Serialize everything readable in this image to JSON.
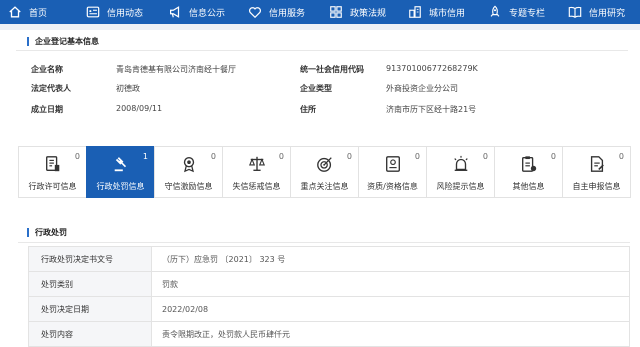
{
  "nav": [
    {
      "label": "首页",
      "icon": "home-icon"
    },
    {
      "label": "信用动态",
      "icon": "news-icon"
    },
    {
      "label": "信息公示",
      "icon": "megaphone-icon"
    },
    {
      "label": "信用服务",
      "icon": "heart-icon"
    },
    {
      "label": "政策法规",
      "icon": "grid-icon"
    },
    {
      "label": "城市信用",
      "icon": "city-icon"
    },
    {
      "label": "专题专栏",
      "icon": "rocket-icon"
    },
    {
      "label": "信用研究",
      "icon": "book-icon"
    }
  ],
  "basic_info": {
    "title": "企业登记基本信息",
    "fields": [
      {
        "label": "企业名称",
        "value": "青岛肯德基有限公司济南经十餐厅"
      },
      {
        "label": "统一社会信用代码",
        "value": "91370100677268279K"
      },
      {
        "label": "法定代表人",
        "value": "初德政"
      },
      {
        "label": "企业类型",
        "value": "外商投资企业分公司"
      },
      {
        "label": "成立日期",
        "value": "2008/09/11"
      },
      {
        "label": "住所",
        "value": "济南市历下区经十路21号"
      }
    ]
  },
  "tabs": [
    {
      "label": "行政许可信息",
      "count": "0",
      "icon": "license-icon"
    },
    {
      "label": "行政处罚信息",
      "count": "1",
      "icon": "gavel-icon"
    },
    {
      "label": "守信激励信息",
      "count": "0",
      "icon": "medal-icon"
    },
    {
      "label": "失信惩戒信息",
      "count": "0",
      "icon": "scales-icon"
    },
    {
      "label": "重点关注信息",
      "count": "0",
      "icon": "target-icon"
    },
    {
      "label": "资质/资格信息",
      "count": "0",
      "icon": "certificate-icon"
    },
    {
      "label": "风险提示信息",
      "count": "0",
      "icon": "alarm-icon"
    },
    {
      "label": "其他信息",
      "count": "0",
      "icon": "clipboard-icon"
    },
    {
      "label": "自主申报信息",
      "count": "0",
      "icon": "report-icon"
    }
  ],
  "active_tab": "行政处罚信息",
  "penalty": {
    "title": "行政处罚",
    "rows": [
      {
        "label": "行政处罚决定书文号",
        "value": "（历下）应急罚 〔2021〕 323 号"
      },
      {
        "label": "处罚类别",
        "value": "罚款"
      },
      {
        "label": "处罚决定日期",
        "value": "2022/02/08"
      },
      {
        "label": "处罚内容",
        "value": "责令限期改正，处罚款人民币肆仟元"
      }
    ]
  },
  "colors": {
    "nav_bg": "#1a5fb4",
    "accent": "#2a6fc9",
    "active_tab_bg": "#1a5fb4"
  }
}
